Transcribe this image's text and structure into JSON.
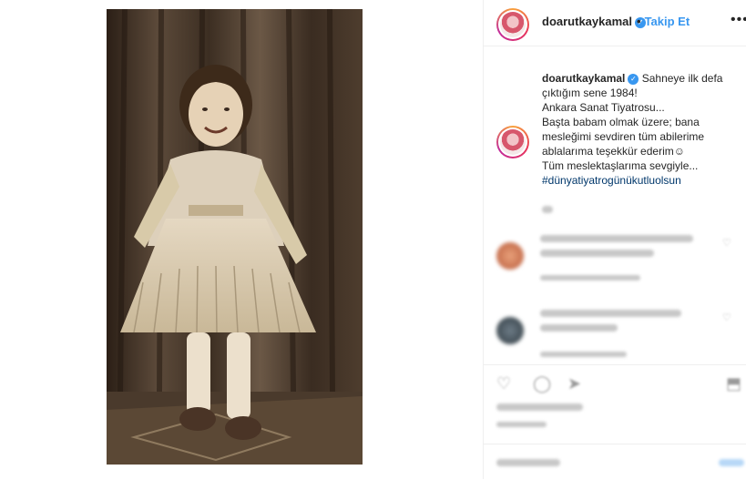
{
  "header": {
    "username": "doarutkaykamal",
    "follow_separator": "•",
    "follow_label": "Takip Et",
    "more_label": "•••"
  },
  "caption": {
    "username": "doarutkaykamal",
    "lines": [
      "Sahneye ilk defa",
      "çıktığım sene 1984!",
      "Ankara Sanat Tiyatrosu...",
      "Başta babam olmak üzere; bana",
      "mesleğimi sevdiren tüm abilerime",
      "ablalarıma teşekkür ederim☺",
      "Tüm meslektaşlarıma sevgiyle..."
    ],
    "hashtag": "#dünyatiyatrogünükutluolsun"
  },
  "icons": {
    "verified": "verified-badge-icon",
    "like": "heart-icon",
    "comment": "comment-icon",
    "share": "share-icon",
    "save": "bookmark-icon"
  },
  "colors": {
    "accent": "#3897f0",
    "hashtag": "#00376b",
    "border": "#efefef"
  }
}
